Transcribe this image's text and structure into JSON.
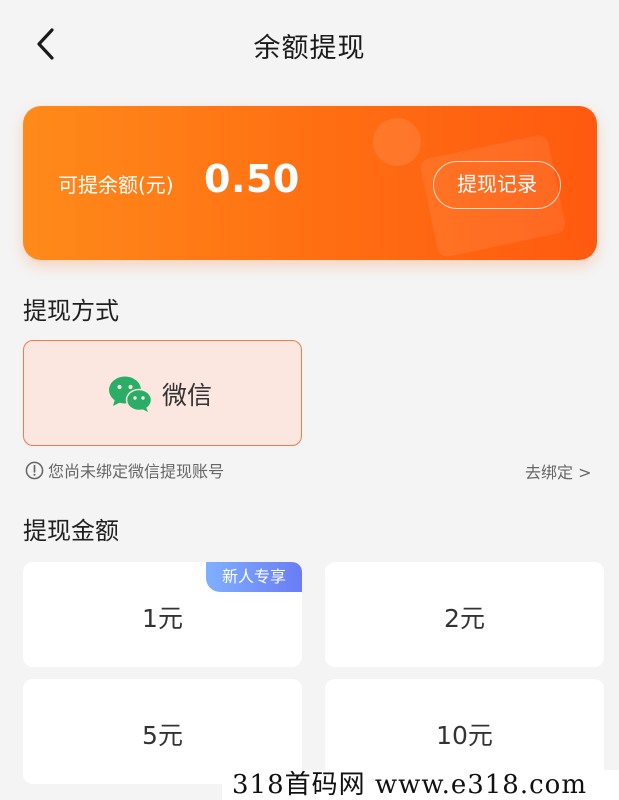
{
  "header": {
    "title": "余额提现",
    "back_icon": "chevron-left-icon"
  },
  "balance": {
    "label": "可提余额(元)",
    "value": "0.50",
    "records_button": "提现记录",
    "gradient_colors": [
      "#ff8a1a",
      "#ff5a10"
    ]
  },
  "method_section": {
    "title": "提现方式",
    "selected_method": {
      "icon": "wechat-icon",
      "label": "微信"
    },
    "notice": "您尚未绑定微信提现账号",
    "notice_icon": "info-circle-icon",
    "bind_link": "去绑定 >"
  },
  "amount_section": {
    "title": "提现金额",
    "options": [
      {
        "label": "1元",
        "badge": "新人专享"
      },
      {
        "label": "2元"
      },
      {
        "label": "5元"
      },
      {
        "label": "10元"
      }
    ]
  },
  "watermark": "318首码网  www.e318.com",
  "colors": {
    "accent": "#ff6d12",
    "selected_border": "#f27a4d",
    "badge": "#6a7cf5",
    "wechat_green": "#2aae67"
  }
}
